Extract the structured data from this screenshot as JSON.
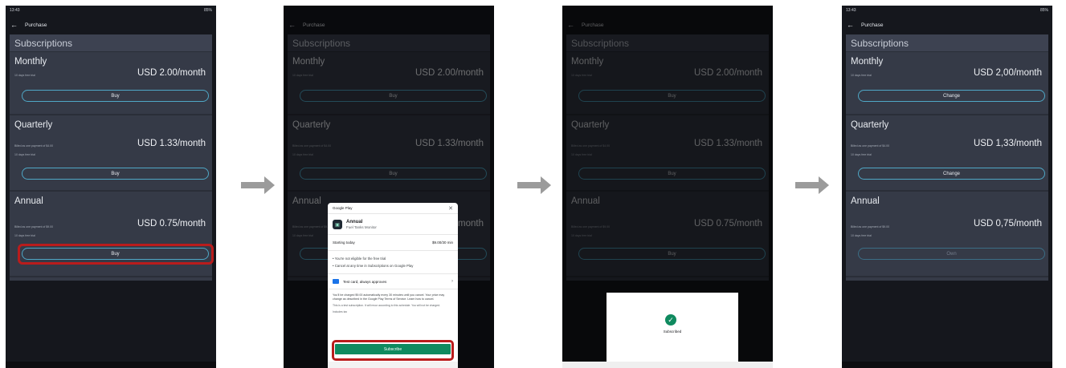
{
  "status_bar": {
    "time": "13:43",
    "battery": "85%"
  },
  "app_bar": {
    "title": "Purchase"
  },
  "section_title": "Subscriptions",
  "screen1": {
    "plans": [
      {
        "name": "Monthly",
        "price": "USD 2.00/month",
        "lines": [
          "10 days free trial"
        ],
        "button": "Buy"
      },
      {
        "name": "Quarterly",
        "price": "USD 1.33/month",
        "lines": [
          "Billed as one payment of $4.00",
          "10 days free trial"
        ],
        "button": "Buy"
      },
      {
        "name": "Annual",
        "price": "USD 0.75/month",
        "lines": [
          "Billed as one payment of $9.00",
          "10 days free trial"
        ],
        "button": "Buy"
      }
    ]
  },
  "screen4": {
    "plans": [
      {
        "name": "Monthly",
        "price": "USD 2,00/month",
        "lines": [
          "10 days free trial"
        ],
        "button": "Change"
      },
      {
        "name": "Quarterly",
        "price": "USD 1,33/month",
        "lines": [
          "Billed as one payment of $4.00",
          "10 days free trial"
        ],
        "button": "Change"
      },
      {
        "name": "Annual",
        "price": "USD 0,75/month",
        "lines": [
          "Billed as one payment of $9.00",
          "10 days free trial"
        ],
        "button": "Own"
      }
    ]
  },
  "google_play": {
    "header": "Google Play",
    "plan_name": "Annual",
    "app_name": "Fuel Tanks Monitor",
    "starting_label": "Starting today",
    "starting_price": "$9.00/30 min",
    "bullet1": "• You're not eligible for the free trial",
    "bullet2": "• Cancel at any time in Subscriptions on Google Play",
    "payment_method": "Test card, always approves",
    "legal": "You'll be charged $9.00 automatically every 30 minutes until you cancel. Your price may change as described in the Google Play Terms of Service. Learn how to cancel.",
    "test_note": "This is a test subscription. It will recur according to this schedule. You will not be charged.",
    "tax_note": "Includes tax",
    "subscribe_label": "Subscribe"
  },
  "subscribed_dialog": {
    "label": "Subscribed"
  },
  "colors": {
    "accent_outline": "#4fa7c6",
    "highlight_red": "#b91c1c",
    "subscribe_green": "#0f8a5f"
  }
}
